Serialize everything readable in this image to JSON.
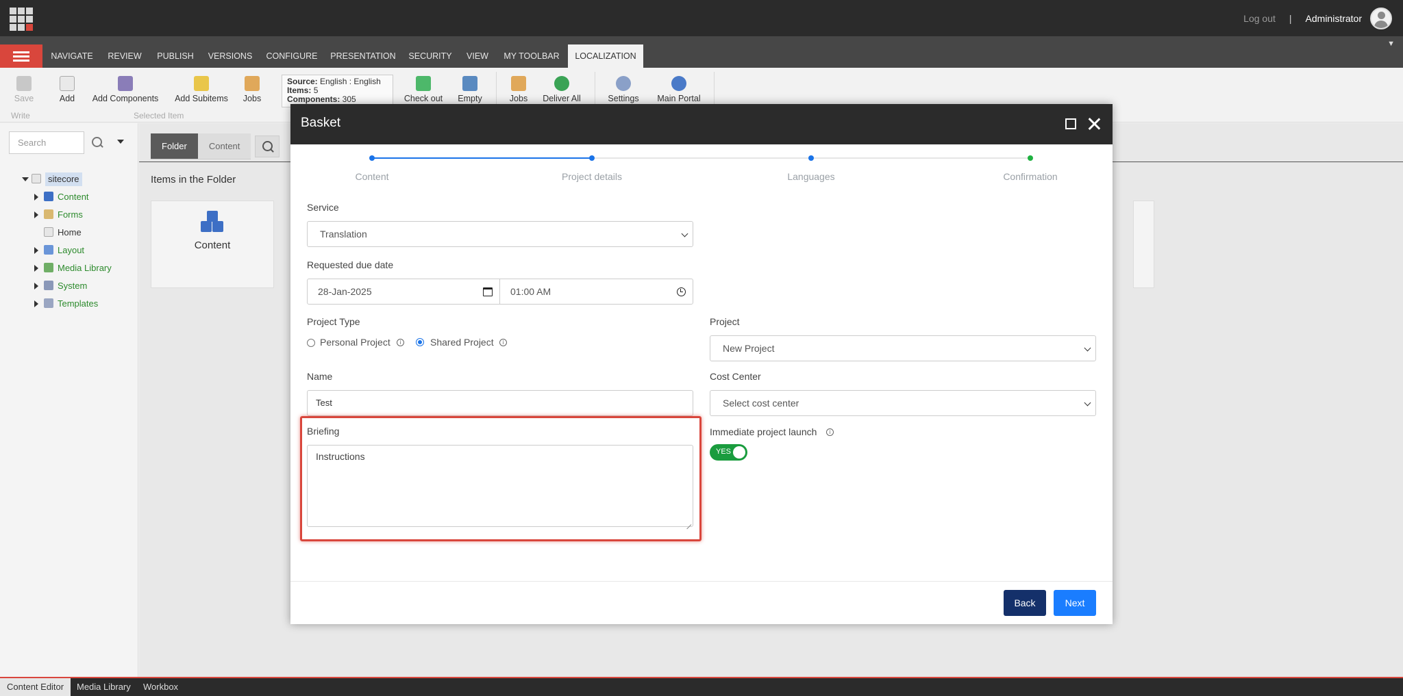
{
  "header": {
    "logout": "Log out",
    "separator": "|",
    "user": "Administrator"
  },
  "ribbon_tabs": [
    "NAVIGATE",
    "REVIEW",
    "PUBLISH",
    "VERSIONS",
    "CONFIGURE",
    "PRESENTATION",
    "SECURITY",
    "VIEW",
    "MY TOOLBAR",
    "LOCALIZATION"
  ],
  "ribbon": {
    "save": "Save",
    "write": "Write",
    "add": "Add",
    "add_components": "Add Components",
    "add_subitems": "Add Subitems",
    "jobs": "Jobs",
    "selected_item": "Selected Item",
    "source_label": "Source:",
    "source_value": "English : English",
    "items_label": "Items:",
    "items_value": "5",
    "components_label": "Components:",
    "components_value": "305",
    "check_out": "Check out",
    "empty": "Empty",
    "jobs2": "Jobs",
    "deliver_all": "Deliver All",
    "settings": "Settings",
    "main_portal": "Main Portal"
  },
  "left": {
    "search_placeholder": "Search",
    "tree": [
      {
        "label": "sitecore"
      },
      {
        "label": "Content"
      },
      {
        "label": "Forms"
      },
      {
        "label": "Home"
      },
      {
        "label": "Layout"
      },
      {
        "label": "Media Library"
      },
      {
        "label": "System"
      },
      {
        "label": "Templates"
      }
    ]
  },
  "content": {
    "tab_folder": "Folder",
    "tab_content": "Content",
    "items_title": "Items in the Folder",
    "card_label": "Content"
  },
  "bottom_tabs": [
    "Content Editor",
    "Media Library",
    "Workbox"
  ],
  "modal": {
    "title": "Basket",
    "steps": [
      "Content",
      "Project details",
      "Languages",
      "Confirmation"
    ],
    "service_label": "Service",
    "service_value": "Translation",
    "due_label": "Requested due date",
    "due_date": "28-Jan-2025",
    "due_time": "01:00 AM",
    "project_type_label": "Project Type",
    "personal_project": "Personal Project",
    "shared_project": "Shared Project",
    "project_label": "Project",
    "project_value": "New Project",
    "name_label": "Name",
    "name_value": "Test",
    "cost_center_label": "Cost Center",
    "cost_center_placeholder": "Select cost center",
    "briefing_label": "Briefing",
    "briefing_value": "Instructions",
    "immediate_label": "Immediate project launch",
    "toggle_text": "YES",
    "back": "Back",
    "next": "Next"
  },
  "colors": {
    "accent_red": "#d9463c",
    "step_blue": "#1a73e8",
    "step_green": "#1fb141",
    "toggle_green": "#1a9c3e",
    "back_button": "#14306a",
    "next_button": "#1a7dff"
  }
}
